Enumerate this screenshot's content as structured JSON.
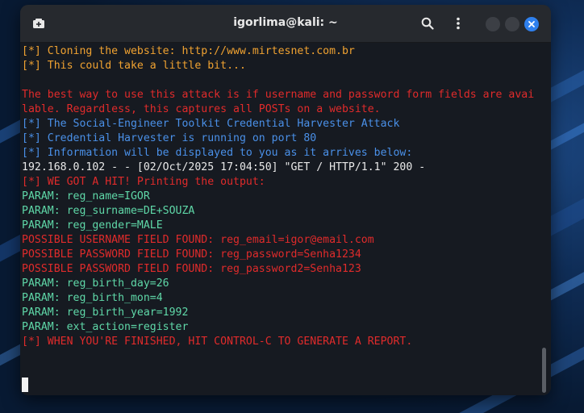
{
  "window": {
    "title": "igorlima@kali: ~"
  },
  "icons": {
    "new_tab": "new-tab-icon",
    "search": "search-icon",
    "menu": "kebab-menu-icon",
    "close": "close-icon"
  },
  "colors": {
    "orange": "#f0a231",
    "red": "#e02b2b",
    "blue": "#4a90e8",
    "green": "#5fd8a8",
    "white": "#e8e8e8",
    "close_button": "#2f80ed"
  },
  "terminal": {
    "lines": [
      {
        "color": "orange",
        "text": "[*] Cloning the website: http://www.mirtesnet.com.br"
      },
      {
        "color": "orange",
        "text": "[*] This could take a little bit..."
      },
      {
        "color": "white",
        "text": ""
      },
      {
        "color": "red",
        "text": "The best way to use this attack is if username and password form fields are avai"
      },
      {
        "color": "red",
        "text": "lable. Regardless, this captures all POSTs on a website."
      },
      {
        "color": "blue",
        "text": "[*] The Social-Engineer Toolkit Credential Harvester Attack"
      },
      {
        "color": "blue",
        "text": "[*] Credential Harvester is running on port 80"
      },
      {
        "color": "blue",
        "text": "[*] Information will be displayed to you as it arrives below:"
      },
      {
        "color": "white",
        "text": "192.168.0.102 - - [02/Oct/2025 17:04:50] \"GET / HTTP/1.1\" 200 -"
      },
      {
        "color": "red",
        "text": "[*] WE GOT A HIT! Printing the output:"
      },
      {
        "color": "green",
        "text": "PARAM: reg_name=IGOR"
      },
      {
        "color": "green",
        "text": "PARAM: reg_surname=DE+SOUZA"
      },
      {
        "color": "green",
        "text": "PARAM: reg_gender=MALE"
      },
      {
        "color": "red",
        "text": "POSSIBLE USERNAME FIELD FOUND: reg_email=igor@email.com"
      },
      {
        "color": "red",
        "text": "POSSIBLE PASSWORD FIELD FOUND: reg_password=Senha1234"
      },
      {
        "color": "red",
        "text": "POSSIBLE PASSWORD FIELD FOUND: reg_password2=Senha123"
      },
      {
        "color": "green",
        "text": "PARAM: reg_birth_day=26"
      },
      {
        "color": "green",
        "text": "PARAM: reg_birth_mon=4"
      },
      {
        "color": "green",
        "text": "PARAM: reg_birth_year=1992"
      },
      {
        "color": "green",
        "text": "PARAM: ext_action=register"
      },
      {
        "color": "red",
        "text": "[*] WHEN YOU'RE FINISHED, HIT CONTROL-C TO GENERATE A REPORT."
      }
    ]
  }
}
